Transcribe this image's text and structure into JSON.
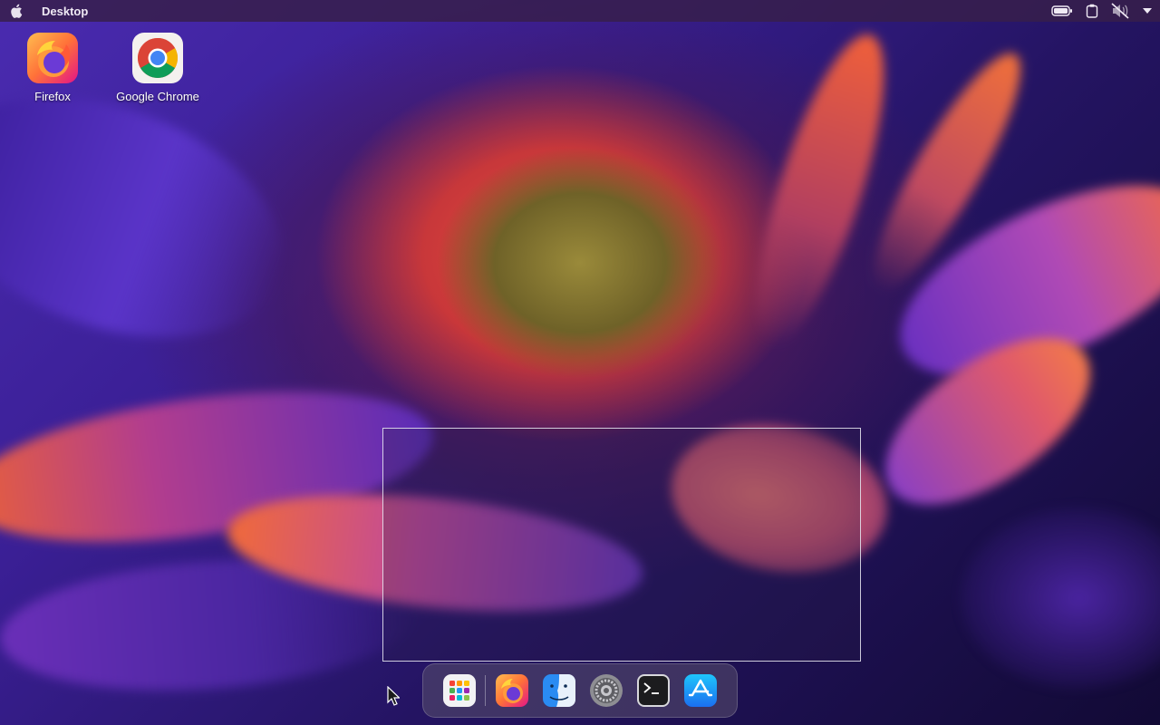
{
  "topbar": {
    "apple_icon": "apple-logo-icon",
    "title": "Desktop",
    "tray_icons": [
      "battery-icon",
      "clipboard-icon",
      "volume-muted-icon",
      "chevron-down-icon"
    ]
  },
  "desktop": {
    "icons": [
      {
        "label": "Firefox",
        "icon": "firefox-icon"
      },
      {
        "label": "Google Chrome",
        "icon": "chrome-icon"
      }
    ]
  },
  "dock": {
    "items": [
      {
        "name": "launchpad",
        "icon": "app-grid-icon"
      },
      {
        "name": "firefox",
        "icon": "firefox-icon"
      },
      {
        "name": "finder",
        "icon": "finder-icon"
      },
      {
        "name": "system-settings",
        "icon": "gear-icon"
      },
      {
        "name": "terminal",
        "icon": "terminal-icon"
      },
      {
        "name": "app-store",
        "icon": "app-store-icon"
      }
    ]
  },
  "colors": {
    "topbar_bg": "#371e4b",
    "chrome_red": "#db4437",
    "chrome_green": "#0f9d58",
    "chrome_yellow": "#f4b400",
    "chrome_blue": "#4285f4",
    "firefox_orange": "#ff7139",
    "firefox_purple": "#6b3ad6"
  }
}
